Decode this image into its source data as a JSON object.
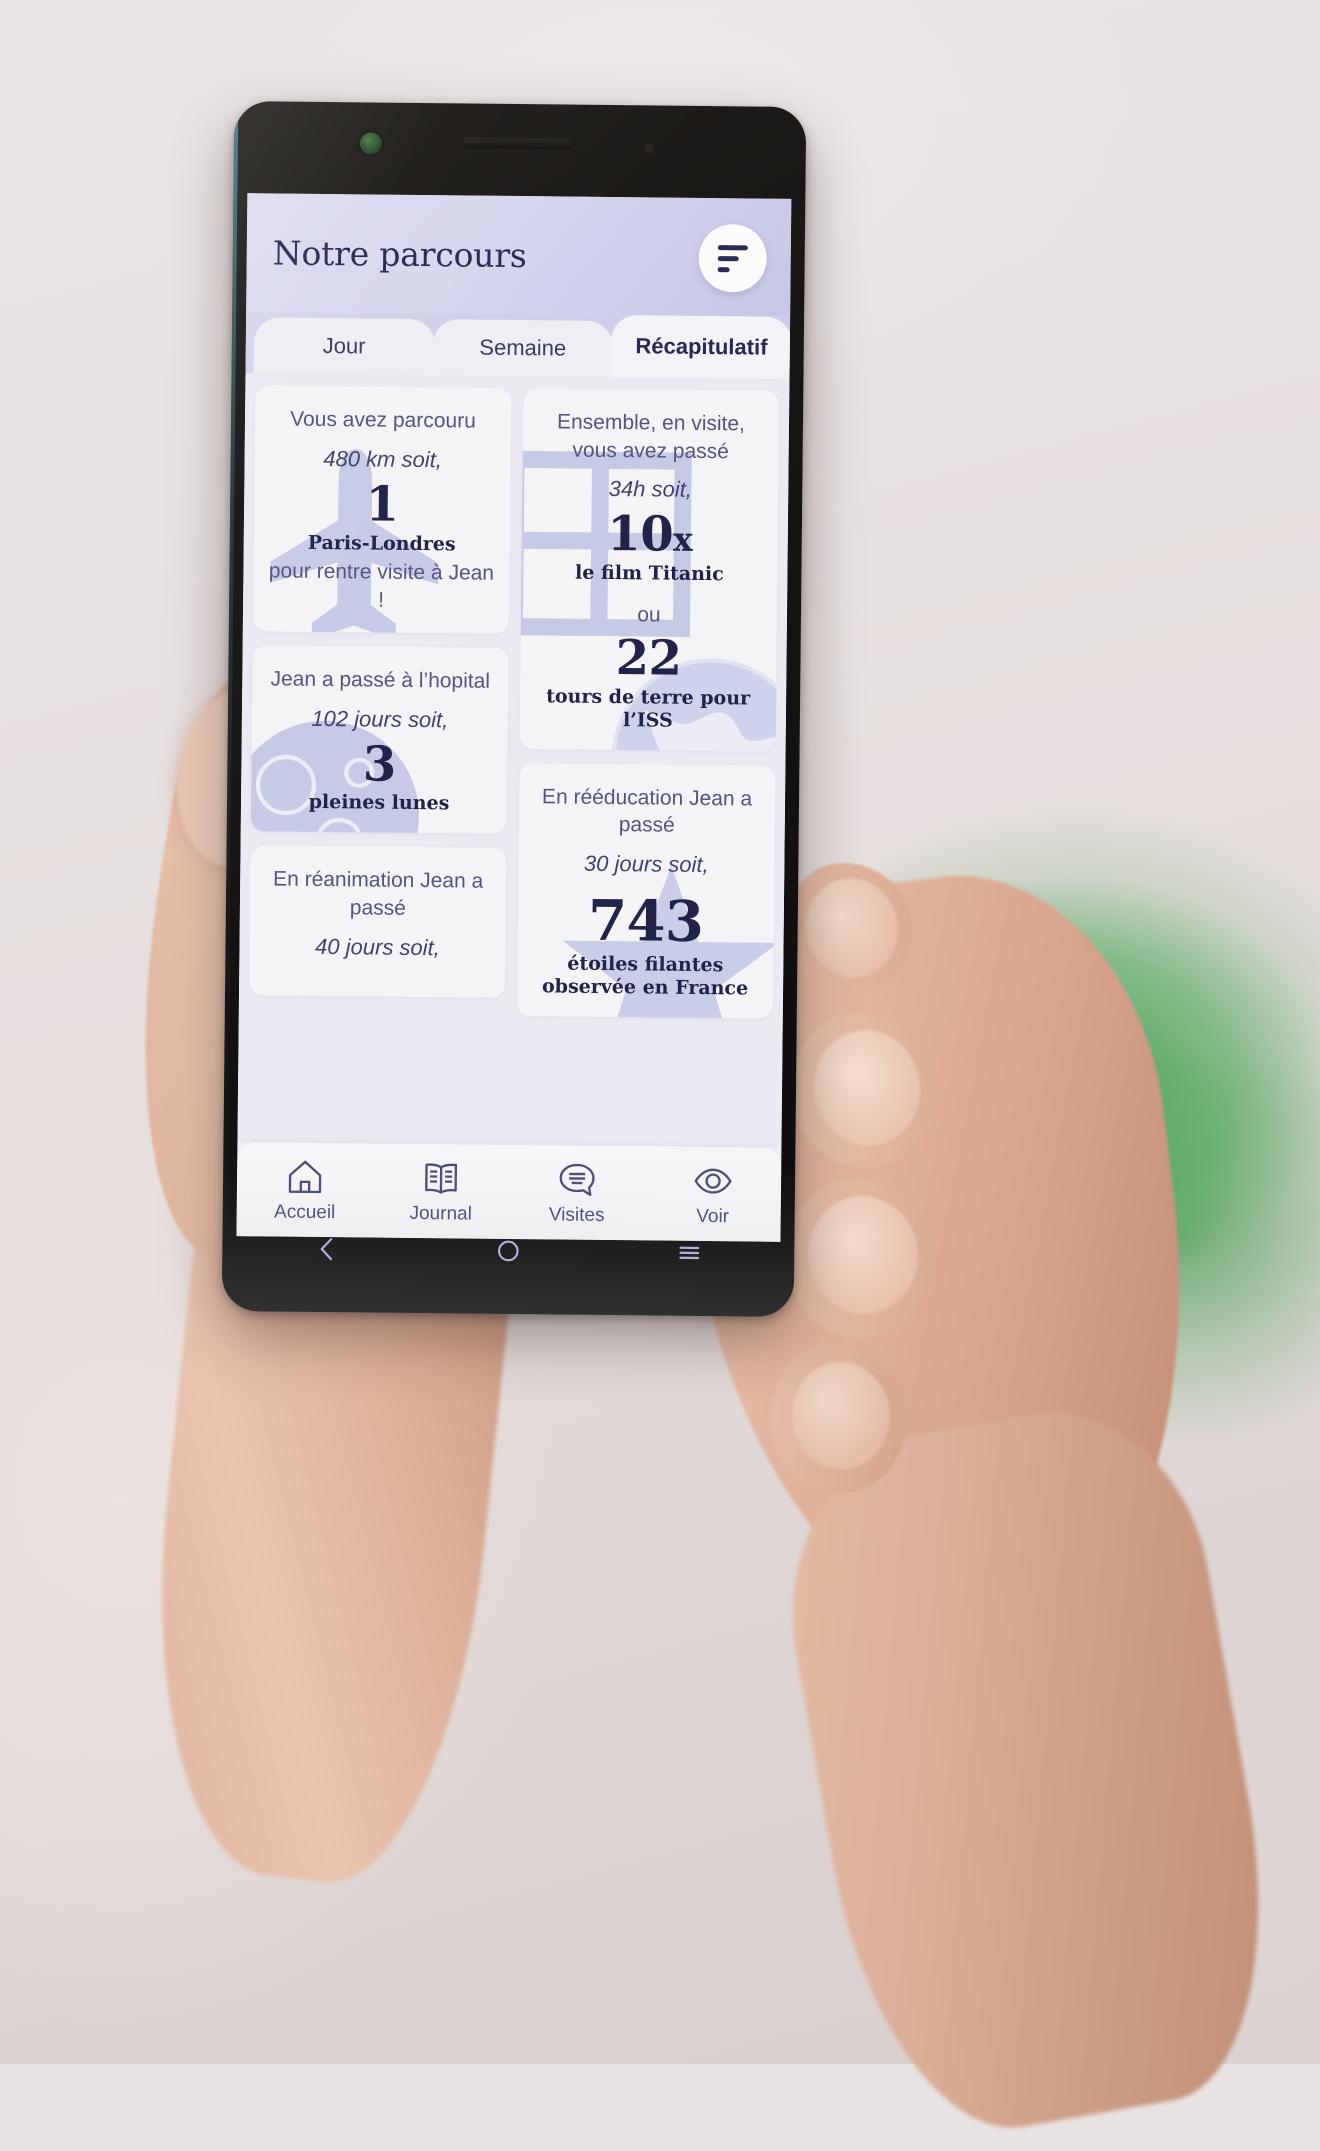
{
  "header": {
    "title": "Notre parcours",
    "filter_icon": "filter-sort-icon"
  },
  "tabs": [
    {
      "label": "Jour",
      "active": false
    },
    {
      "label": "Semaine",
      "active": false
    },
    {
      "label": "Récapitulatif",
      "active": true
    }
  ],
  "cards": [
    {
      "id": "distance-card",
      "watermark": "airplane-icon",
      "intro": "Vous avez parcouru",
      "measure": "480 km soit,",
      "number": "1",
      "suffix": "",
      "label": "Paris-Londres",
      "outro": "pour rentre visite à Jean !"
    },
    {
      "id": "visit-time-card",
      "watermark": "film-strip-icon",
      "intro": "Ensemble, en visite, vous avez passé",
      "measure": "34h soit,",
      "number": "10",
      "suffix": "x",
      "label": "le film Titanic",
      "separator": "ou",
      "watermark2": "globe-icon",
      "number2": "22",
      "label2": "tours de terre pour l’ISS"
    },
    {
      "id": "hospital-card",
      "watermark": "moon-icon",
      "intro": "Jean a passé à l’hopital",
      "measure": "102 jours soit,",
      "number": "3",
      "suffix": "",
      "label": "pleines lunes"
    },
    {
      "id": "rehab-card",
      "watermark": "star-icon",
      "intro": "En rééducation Jean a passé",
      "measure": "30 jours soit,",
      "number": "743",
      "suffix": "",
      "label": "étoiles filantes observée en France"
    },
    {
      "id": "icu-card",
      "watermark": "",
      "intro": "En réanimation Jean a passé",
      "measure": "40 jours soit,",
      "number": "",
      "suffix": "",
      "label": ""
    }
  ],
  "bottom_nav": [
    {
      "label": "Accueil",
      "icon": "home-icon"
    },
    {
      "label": "Journal",
      "icon": "book-icon"
    },
    {
      "label": "Visites",
      "icon": "chat-bubble-icon"
    },
    {
      "label": "Voir",
      "icon": "eye-icon"
    }
  ],
  "system_bar": [
    {
      "name": "back-button",
      "icon": "chevron-left-icon"
    },
    {
      "name": "home-button",
      "icon": "circle-icon"
    },
    {
      "name": "recents-button",
      "icon": "menu-lines-icon"
    }
  ],
  "colors": {
    "accent_dark": "#222348",
    "text_muted": "#53557e",
    "header_bg": "#d6d6ee",
    "card_bg": "#f4f4f6",
    "watermark": "#c3c7e4"
  }
}
